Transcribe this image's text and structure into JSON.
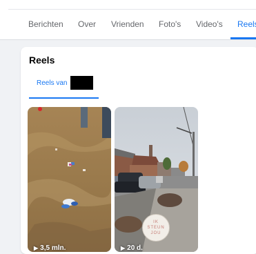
{
  "nav": {
    "tabs": [
      {
        "label": "Berichten"
      },
      {
        "label": "Over"
      },
      {
        "label": "Vrienden"
      },
      {
        "label": "Foto's"
      },
      {
        "label": "Video's"
      },
      {
        "label": "Reels"
      }
    ],
    "active": "Reels",
    "accent_color": "#1877f2"
  },
  "reels_card": {
    "title": "Reels",
    "subtab_label": "Reels van",
    "items": [
      {
        "views": "3,5 mln."
      },
      {
        "views": "20 d."
      }
    ]
  },
  "logo_text": {
    "line1": "IK",
    "line2": "STEUN",
    "line3": "JOU"
  }
}
